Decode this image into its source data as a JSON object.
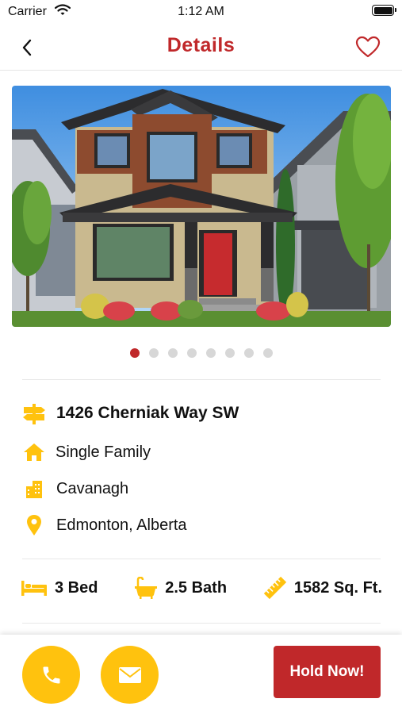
{
  "status_bar": {
    "carrier": "Carrier",
    "time": "1:12 AM"
  },
  "header": {
    "title": "Details",
    "back_icon": "chevron-left-icon",
    "favorite_icon": "heart-outline-icon"
  },
  "gallery": {
    "image": "house-photo",
    "total_images": 8,
    "active_index": 0
  },
  "listing": {
    "address": "1426 Cherniak Way SW",
    "property_type": "Single Family",
    "community": "Cavanagh",
    "city": "Edmonton, Alberta"
  },
  "specs": {
    "beds": "3 Bed",
    "baths": "2.5 Bath",
    "area": "1582 Sq. Ft."
  },
  "actions": {
    "call_icon": "phone-icon",
    "email_icon": "mail-icon",
    "hold_label": "Hold Now!"
  },
  "colors": {
    "accent": "#c0282a",
    "icon_yellow": "#ffc20e"
  }
}
